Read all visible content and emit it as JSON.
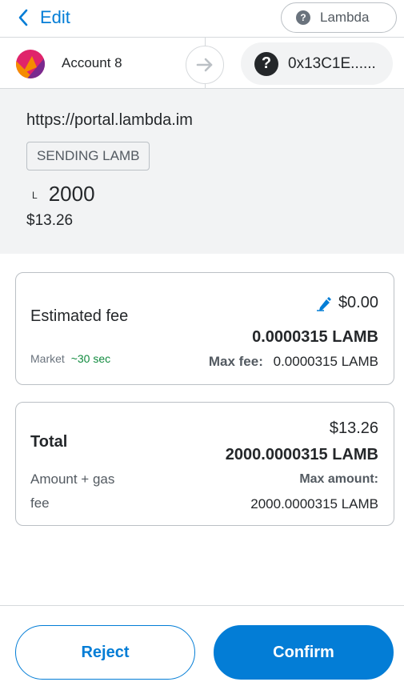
{
  "header": {
    "edit_label": "Edit",
    "network_name": "Lambda",
    "network_icon": "question-mark-icon"
  },
  "sender": {
    "account_name": "Account 8",
    "avatar_colors": [
      "#e0246b",
      "#f58c00",
      "#7a2a8f"
    ]
  },
  "recipient": {
    "address": "0x13C1E......",
    "icon": "question-mark-icon"
  },
  "summary": {
    "origin": "https://portal.lambda.im",
    "action": "SENDING LAMB",
    "token_symbol": "L",
    "amount": "2000",
    "fiat": "$13.26"
  },
  "fee": {
    "label": "Estimated fee",
    "fiat": "$0.00",
    "native": "0.0000315 LAMB",
    "market_label": "Market",
    "market_time": "~30 sec",
    "max_fee_label": "Max fee:",
    "max_fee_value": "0.0000315 LAMB"
  },
  "total": {
    "label": "Total",
    "sub_line1": "Amount + gas",
    "sub_line2": "fee",
    "fiat": "$13.26",
    "native": "2000.0000315 LAMB",
    "max_amount_label": "Max amount:",
    "max_amount_value": "2000.0000315 LAMB"
  },
  "footer": {
    "reject_label": "Reject",
    "confirm_label": "Confirm"
  },
  "colors": {
    "primary": "#037dd6",
    "success": "#118b3f",
    "background_muted": "#f2f3f4",
    "border": "#bbc0c5"
  }
}
